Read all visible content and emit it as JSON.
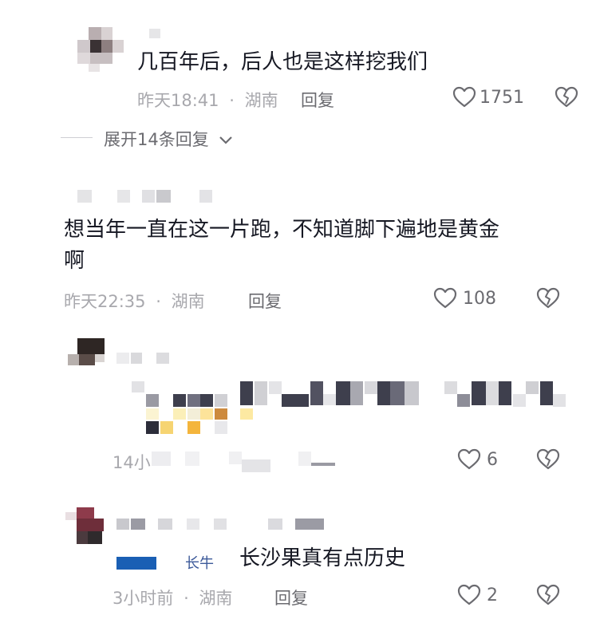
{
  "comments": [
    {
      "text": "几百年后，后人也是这样挖我们",
      "time": "昨天18:41",
      "sep": "·",
      "location": "湖南",
      "reply_label": "回复",
      "likes": "1751",
      "expand_label": "展开14条回复"
    },
    {
      "text_line1": "想当年一直在这一片跑，不知道脚下遍地是黄金",
      "text_line2": "啊",
      "time": "昨天22:35",
      "sep": "·",
      "location": "湖南",
      "reply_label": "回复",
      "likes": "108"
    },
    {
      "time_partial": "14小",
      "likes": "6"
    },
    {
      "text": "长沙果真有点历史",
      "mention_partial": "长牛",
      "time": "3小时前",
      "sep": "·",
      "location": "湖南",
      "reply_label": "回复",
      "likes": "2"
    }
  ],
  "icons": {
    "like": "heart-outline-icon",
    "dislike": "broken-heart-icon",
    "expand": "chevron-down-icon"
  },
  "colors": {
    "text": "#161823",
    "meta": "#a8a8ad",
    "icon": "#6b6b70"
  }
}
